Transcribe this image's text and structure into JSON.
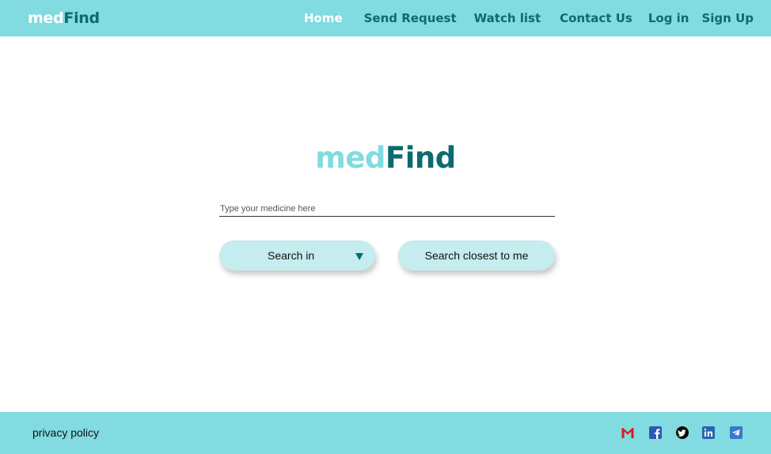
{
  "header": {
    "brand": {
      "part1": "med",
      "part2": "Find"
    },
    "nav": {
      "home": "Home",
      "send_request": "Send Request",
      "watch_list": "Watch list",
      "contact_us": "Contact Us",
      "log_in": "Log in",
      "sign_up": "Sign Up"
    }
  },
  "main": {
    "logo": {
      "part1": "med",
      "part2": "Find"
    },
    "search": {
      "placeholder": "Type your medicine here",
      "value": ""
    },
    "search_in_label": "Search in",
    "search_closest_label": "Search closest to me"
  },
  "footer": {
    "privacy_label": "privacy policy",
    "social_icons": [
      "gmail-icon",
      "facebook-icon",
      "twitter-icon",
      "linkedin-icon",
      "telegram-icon"
    ]
  },
  "colors": {
    "accent": "#81dbe0",
    "brand_dark": "#0c6b6f",
    "button_bg": "#c5ecee"
  }
}
